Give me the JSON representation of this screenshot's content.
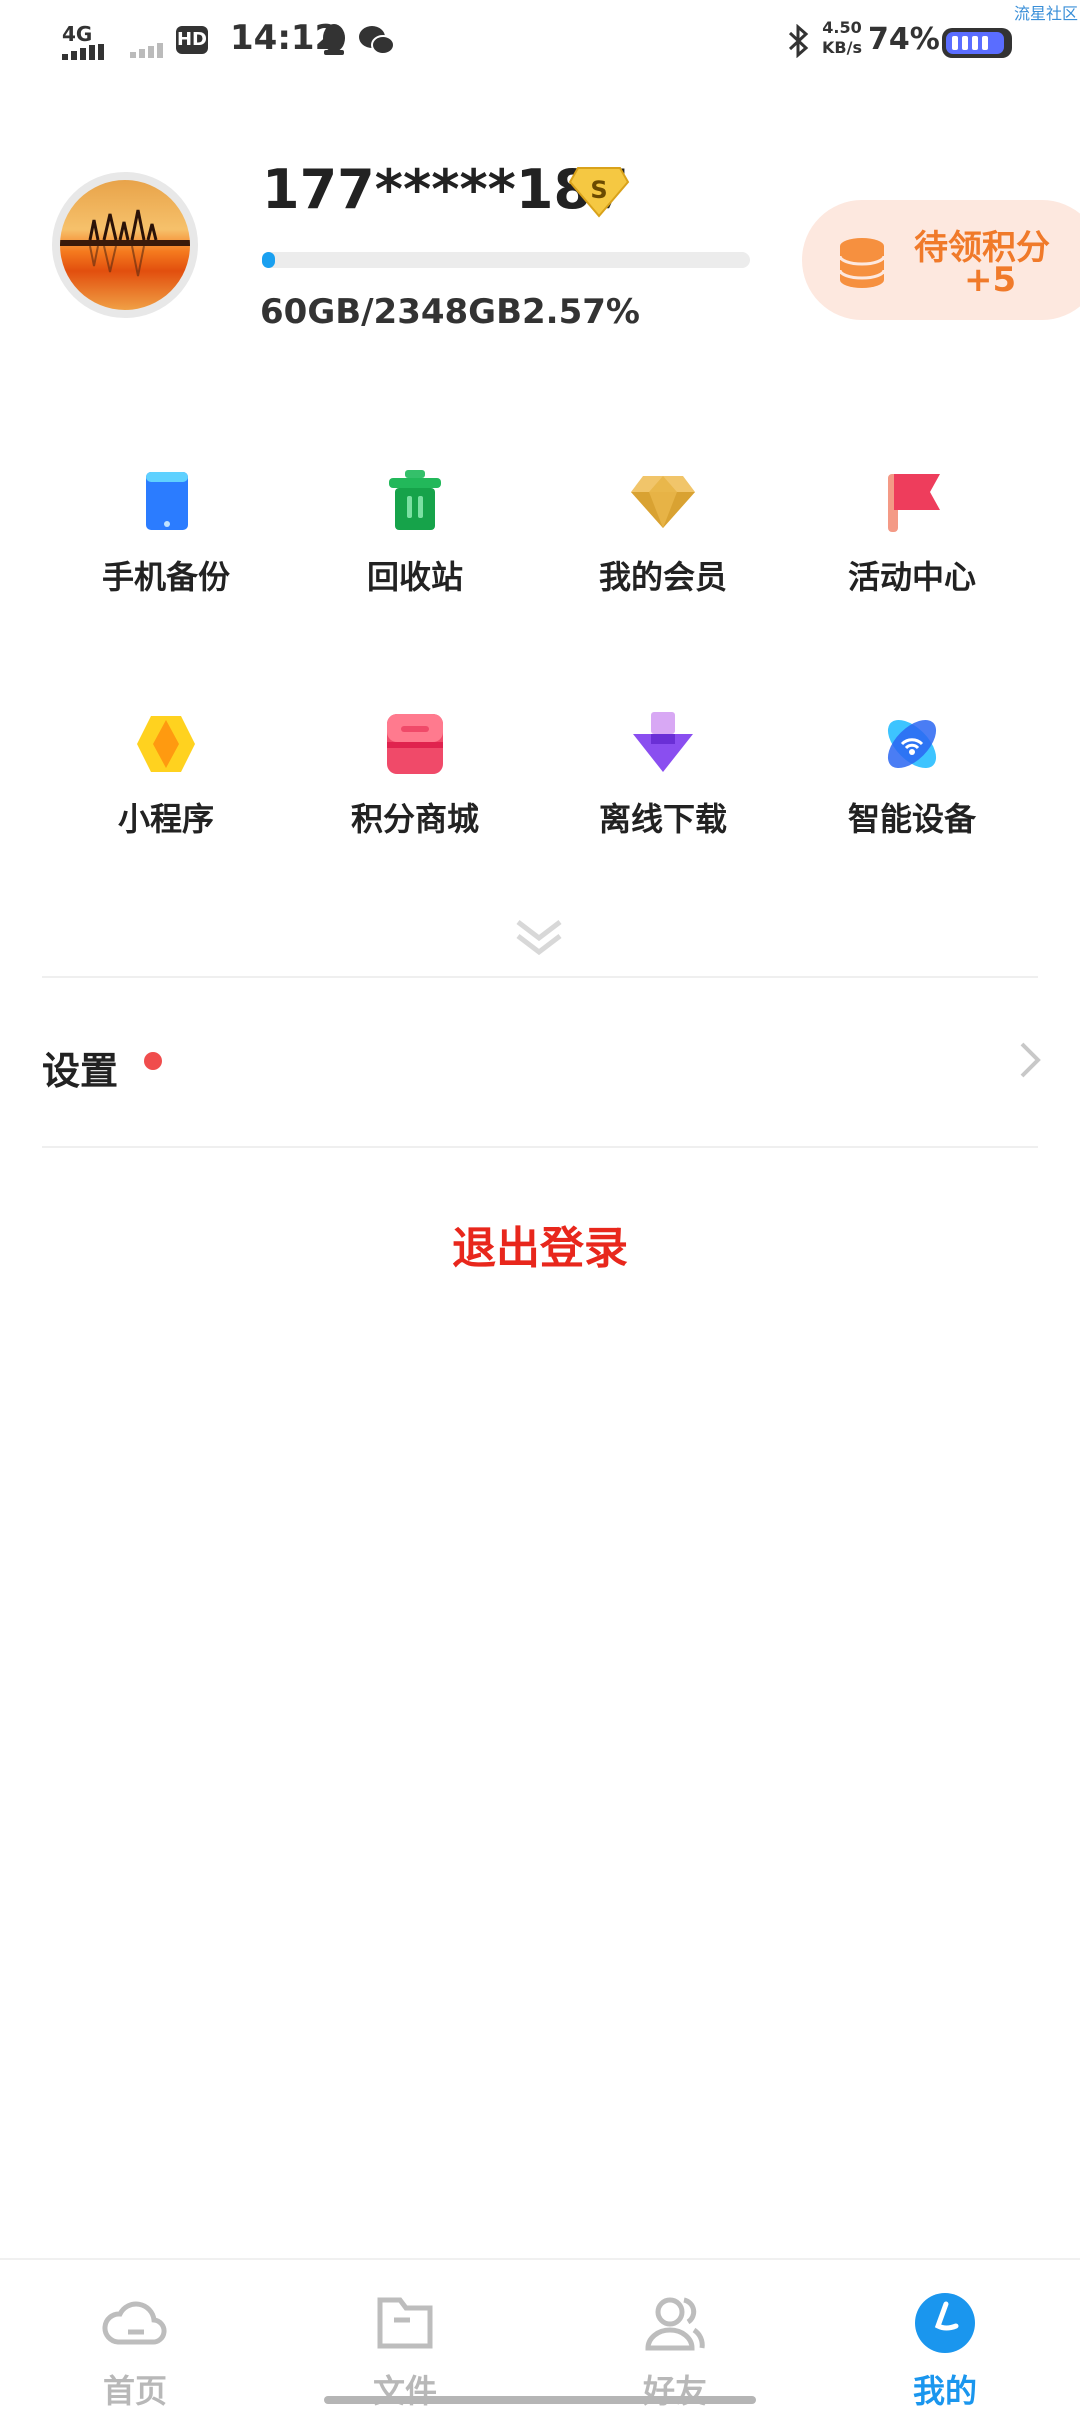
{
  "status_bar": {
    "network": "4G",
    "hd": "HD",
    "time": "14:12",
    "speed_value": "4.50",
    "speed_unit": "KB/s",
    "battery_percent": "74%",
    "watermark": "流星社区"
  },
  "profile": {
    "username": "177*****187",
    "vip_badge": "S",
    "storage_used_fraction": 0.0257,
    "storage_text": "60GB/2348GB",
    "storage_percent": "2.57%"
  },
  "points_card": {
    "title": "待领积分",
    "value": "+5"
  },
  "grid": [
    {
      "label": "手机备份",
      "icon": "phone-backup-icon"
    },
    {
      "label": "回收站",
      "icon": "recycle-bin-icon"
    },
    {
      "label": "我的会员",
      "icon": "diamond-icon"
    },
    {
      "label": "活动中心",
      "icon": "flag-icon"
    },
    {
      "label": "小程序",
      "icon": "mini-program-icon"
    },
    {
      "label": "积分商城",
      "icon": "shop-icon"
    },
    {
      "label": "离线下载",
      "icon": "download-icon"
    },
    {
      "label": "智能设备",
      "icon": "smart-device-icon"
    }
  ],
  "settings": {
    "label": "设置"
  },
  "logout": {
    "label": "退出登录"
  },
  "tabs": [
    {
      "label": "首页",
      "icon": "cloud-icon"
    },
    {
      "label": "文件",
      "icon": "folder-icon"
    },
    {
      "label": "好友",
      "icon": "friends-icon"
    },
    {
      "label": "我的",
      "icon": "me-icon"
    }
  ],
  "colors": {
    "accent": "#1a96ee",
    "logout_red": "#e8271c",
    "points_orange": "#f07a2a"
  }
}
